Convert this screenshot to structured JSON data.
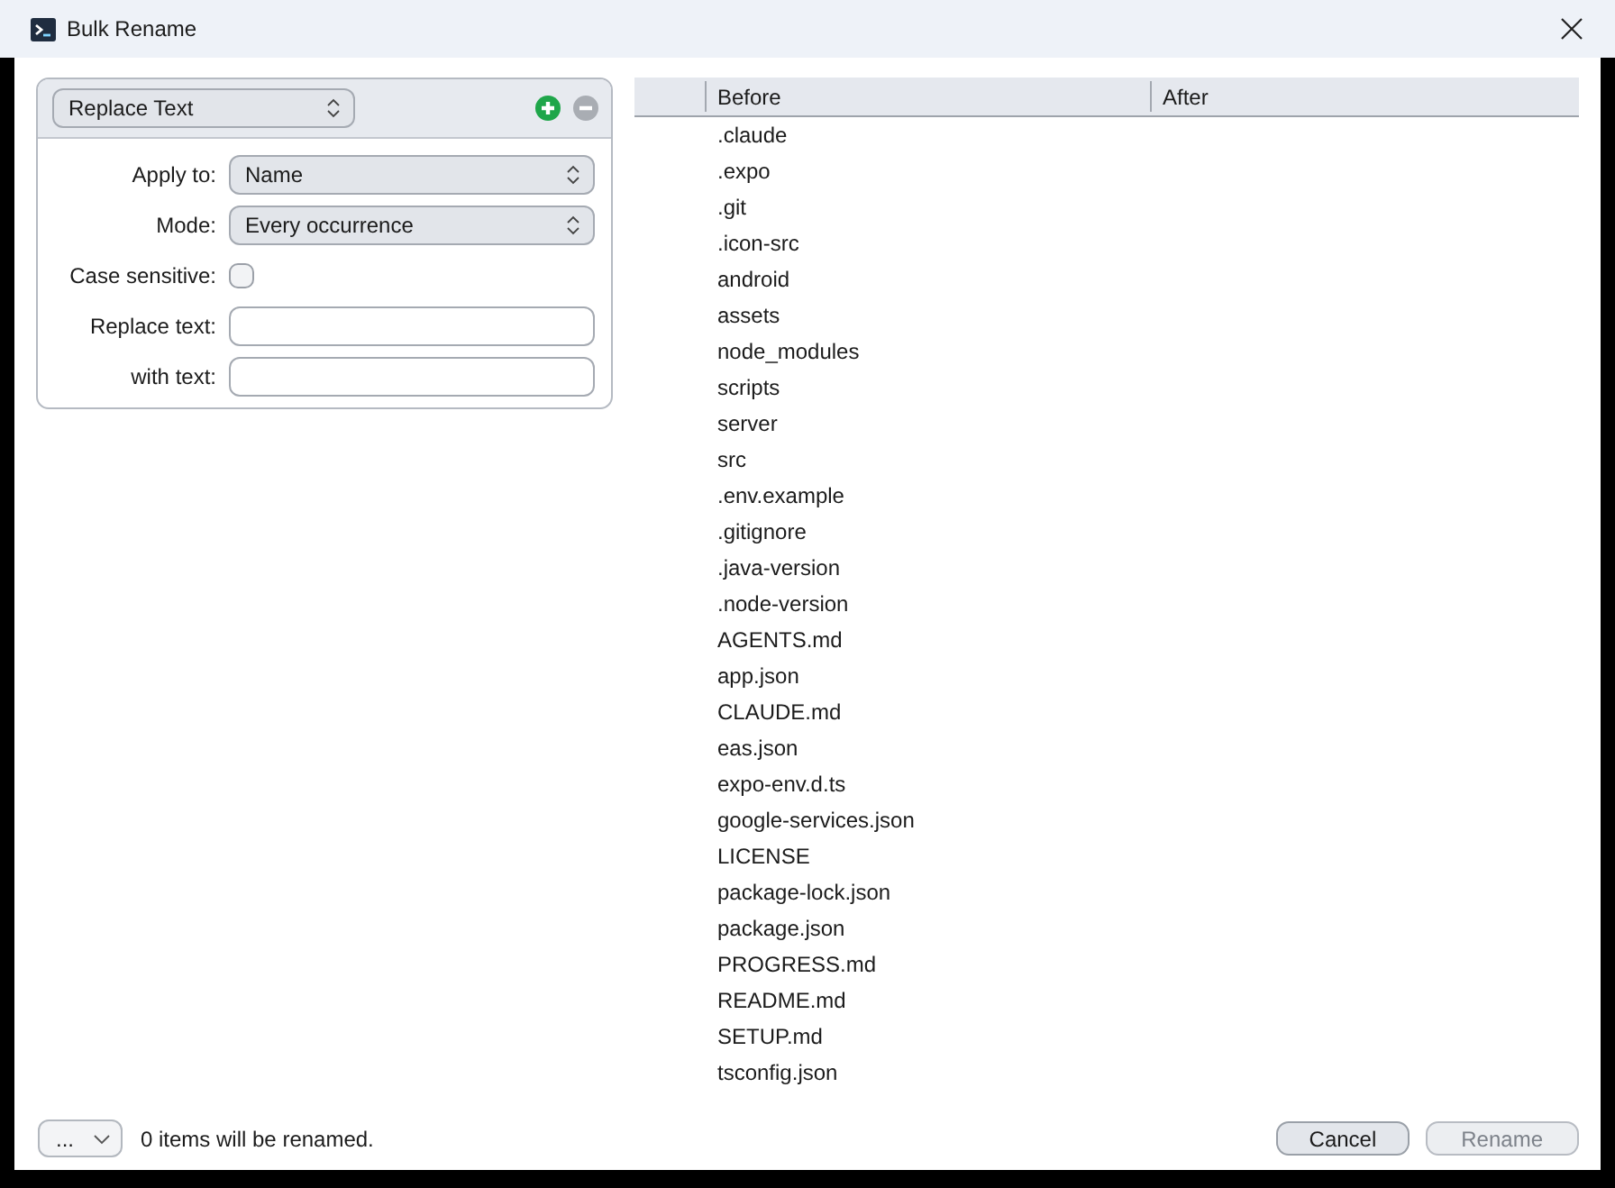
{
  "window": {
    "title": "Bulk Rename"
  },
  "rule": {
    "type": "Replace Text",
    "fields": [
      {
        "kind": "select",
        "label": "Apply to:",
        "value": "Name"
      },
      {
        "kind": "select",
        "label": "Mode:",
        "value": "Every occurrence"
      },
      {
        "kind": "checkbox",
        "label": "Case sensitive:",
        "checked": false
      },
      {
        "kind": "text",
        "label": "Replace text:"
      },
      {
        "kind": "text",
        "label": "with text:"
      }
    ]
  },
  "table": {
    "columns": [
      "Before",
      "After"
    ],
    "rows": [
      ".claude",
      ".expo",
      ".git",
      ".icon-src",
      "android",
      "assets",
      "node_modules",
      "scripts",
      "server",
      "src",
      ".env.example",
      ".gitignore",
      ".java-version",
      ".node-version",
      "AGENTS.md",
      "app.json",
      "CLAUDE.md",
      "eas.json",
      "expo-env.d.ts",
      "google-services.json",
      "LICENSE",
      "package-lock.json",
      "package.json",
      "PROGRESS.md",
      "README.md",
      "SETUP.md",
      "tsconfig.json"
    ]
  },
  "footer": {
    "menu_button": "...",
    "status": "0 items will be renamed.",
    "buttons": [
      {
        "label": "Cancel",
        "disabled": false
      },
      {
        "label": "Rename",
        "disabled": true
      }
    ]
  }
}
